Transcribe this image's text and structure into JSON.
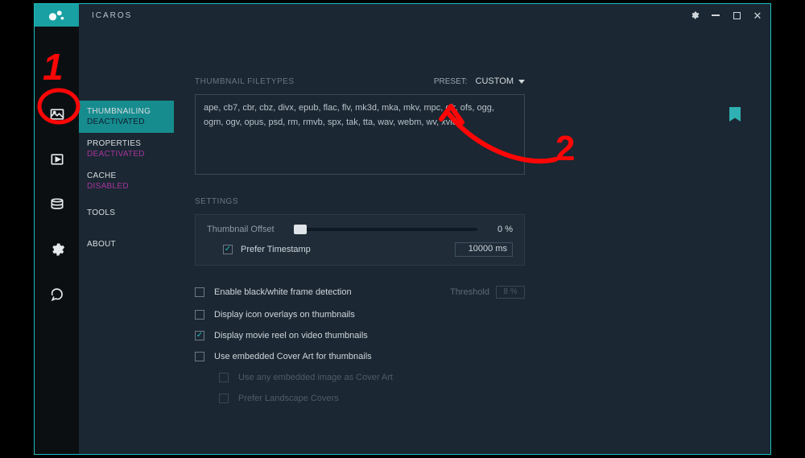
{
  "titlebar": {
    "app_name": "ICAROS"
  },
  "nav": {
    "items": [
      {
        "label": "THUMBNAILING",
        "status": "DEACTIVATED"
      },
      {
        "label": "PROPERTIES",
        "status": "DEACTIVATED"
      },
      {
        "label": "CACHE",
        "status": "DISABLED"
      },
      {
        "label": "TOOLS",
        "status": ""
      },
      {
        "label": "ABOUT",
        "status": ""
      }
    ]
  },
  "filetypes": {
    "header": "THUMBNAIL FILETYPES",
    "preset_label": "PRESET:",
    "preset_value": "CUSTOM",
    "list": "ape, cb7, cbr, cbz, divx, epub, flac, flv, mk3d, mka, mkv, mpc, ofr, ofs, ogg, ogm, ogv, opus, psd, rm, rmvb, spx, tak, tta, wav, webm, wv, xvid"
  },
  "settings": {
    "header": "SETTINGS",
    "offset_label": "Thumbnail Offset",
    "offset_pct": "0 %",
    "prefer_ts_label": "Prefer Timestamp",
    "prefer_ts_value": "10000 ms",
    "options": [
      {
        "label": "Enable black/white frame detection",
        "checked": false,
        "threshold_label": "Threshold",
        "threshold_value": "8 %"
      },
      {
        "label": "Display icon overlays on thumbnails",
        "checked": false
      },
      {
        "label": "Display movie reel on video thumbnails",
        "checked": true
      },
      {
        "label": "Use embedded Cover Art for thumbnails",
        "checked": false
      }
    ],
    "sub_options": [
      {
        "label": "Use any embedded image as Cover Art"
      },
      {
        "label": "Prefer Landscape Covers"
      }
    ]
  },
  "annotations": {
    "one": "1",
    "two": "2"
  }
}
